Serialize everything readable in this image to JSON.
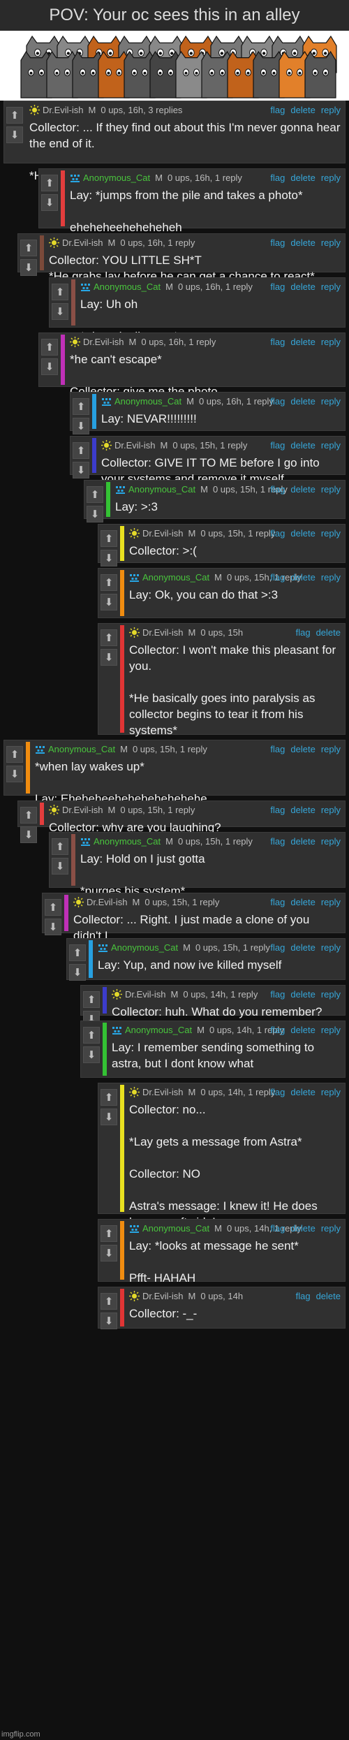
{
  "title": "POV: Your oc sees this in an alley",
  "watermark": "imgflip.com",
  "users": {
    "evil": {
      "name": "Dr.Evil-ish",
      "badge": "M",
      "avatar": "sun-avatar-icon",
      "color": "#bdbdbd"
    },
    "cat": {
      "name": "Anonymous_Cat",
      "badge": "M",
      "avatar": "pixel-avatar-icon",
      "color": "#49c43d"
    }
  },
  "actions": {
    "flag": "flag",
    "delete": "delete",
    "reply": "reply"
  },
  "vote_up": "⬆",
  "vote_down": "⬇",
  "comments": [
    {
      "user": "Dr.Evil-ish",
      "badge": "M",
      "stats": "0 ups, 16h, 3 replies",
      "bar": "",
      "text": "Collector: ... If they find out about this I'm never gonna hear the end of it.\n\n*He starts petting a couple of them*"
    },
    {
      "user": "Anonymous_Cat",
      "badge": "M",
      "stats": "0 ups, 16h, 1 reply",
      "bar": "#e23d3d",
      "text": "Lay: *jumps from the pile and takes a photo*\n\neheheheeheheheheh"
    },
    {
      "user": "Dr.Evil-ish",
      "badge": "M",
      "stats": "0 ups, 16h, 1 reply",
      "bar": "#7a4a3a",
      "text": "Collector: YOU LITTLE SH*T\n*He grabs lay before he can get a chance to react*"
    },
    {
      "user": "Anonymous_Cat",
      "badge": "M",
      "stats": "0 ups, 16h, 1 reply",
      "bar": "#8a4f46",
      "text": "Lay: Uh oh\n\n*tries wiggling out*"
    },
    {
      "user": "Dr.Evil-ish",
      "badge": "M",
      "stats": "0 ups, 16h, 1 reply",
      "bar": "#c030b8",
      "text": "*he can't escape*\n\nCollector: give me the photo."
    },
    {
      "user": "Anonymous_Cat",
      "badge": "M",
      "stats": "0 ups, 16h, 1 reply",
      "bar": "#27a0e0",
      "text": "Lay: NEVAR!!!!!!!!!"
    },
    {
      "user": "Dr.Evil-ish",
      "badge": "M",
      "stats": "0 ups, 15h, 1 reply",
      "bar": "#3c3ccc",
      "text": "Collector: GIVE IT TO ME before I go into your systems and remove it myself."
    },
    {
      "user": "Anonymous_Cat",
      "badge": "M",
      "stats": "0 ups, 15h, 1 reply",
      "bar": "#34c234",
      "text": "Lay: >:3"
    },
    {
      "user": "Dr.Evil-ish",
      "badge": "M",
      "stats": "0 ups, 15h, 1 reply",
      "bar": "#e8e020",
      "text": "Collector: >:("
    },
    {
      "user": "Anonymous_Cat",
      "badge": "M",
      "stats": "0 ups, 15h, 1 reply",
      "bar": "#f08c10",
      "text": "Lay: Ok, you can do that >:3"
    },
    {
      "user": "Dr.Evil-ish",
      "badge": "M",
      "stats": "0 ups, 15h",
      "bar": "#e03535",
      "text": "Collector: I won't make this pleasant for you.\n\n*He basically goes into paralysis as collector begins to tear it from his systems*"
    },
    {
      "user": "Anonymous_Cat",
      "badge": "M",
      "stats": "0 ups, 15h, 1 reply",
      "bar": "#f08c10",
      "text": "*when lay wakes up*\n\nLay: Eheheheehehehehehehehe"
    },
    {
      "user": "Dr.Evil-ish",
      "badge": "M",
      "stats": "0 ups, 15h, 1 reply",
      "bar": "#e23d3d",
      "text": "Collector: why are you laughing?"
    },
    {
      "user": "Anonymous_Cat",
      "badge": "M",
      "stats": "0 ups, 15h, 1 reply",
      "bar": "#8a4f46",
      "text": "Lay: Hold on I just gotta\n\n*purges his system*"
    },
    {
      "user": "Dr.Evil-ish",
      "badge": "M",
      "stats": "0 ups, 15h, 1 reply",
      "bar": "#c030b8",
      "text": "Collector: ... Right. I just made a clone of you didn't I."
    },
    {
      "user": "Anonymous_Cat",
      "badge": "M",
      "stats": "0 ups, 15h, 1 reply",
      "bar": "#27a0e0",
      "text": "Lay: Yup, and now ive killed myself"
    },
    {
      "user": "Dr.Evil-ish",
      "badge": "M",
      "stats": "0 ups, 14h, 1 reply",
      "bar": "#3c3ccc",
      "text": "Collector: huh. What do you remember?"
    },
    {
      "user": "Anonymous_Cat",
      "badge": "M",
      "stats": "0 ups, 14h, 1 reply",
      "bar": "#34c234",
      "text": "Lay: I remember sending something to astra, but I dont know what"
    },
    {
      "user": "Dr.Evil-ish",
      "badge": "M",
      "stats": "0 ups, 14h, 1 reply",
      "bar": "#e8e020",
      "text": "Collector: no...\n\n*Lay gets a message from Astra*\n\nCollector: NO\n\nAstra's message: I knew it! He does have a soft side!"
    },
    {
      "user": "Anonymous_Cat",
      "badge": "M",
      "stats": "0 ups, 14h, 1 reply",
      "bar": "#f08c10",
      "text": "Lay: *looks at message he sent*\n\nPfft- HAHAH"
    },
    {
      "user": "Dr.Evil-ish",
      "badge": "M",
      "stats": "0 ups, 14h",
      "bar": "#e03535",
      "text": "Collector: -_-"
    }
  ]
}
